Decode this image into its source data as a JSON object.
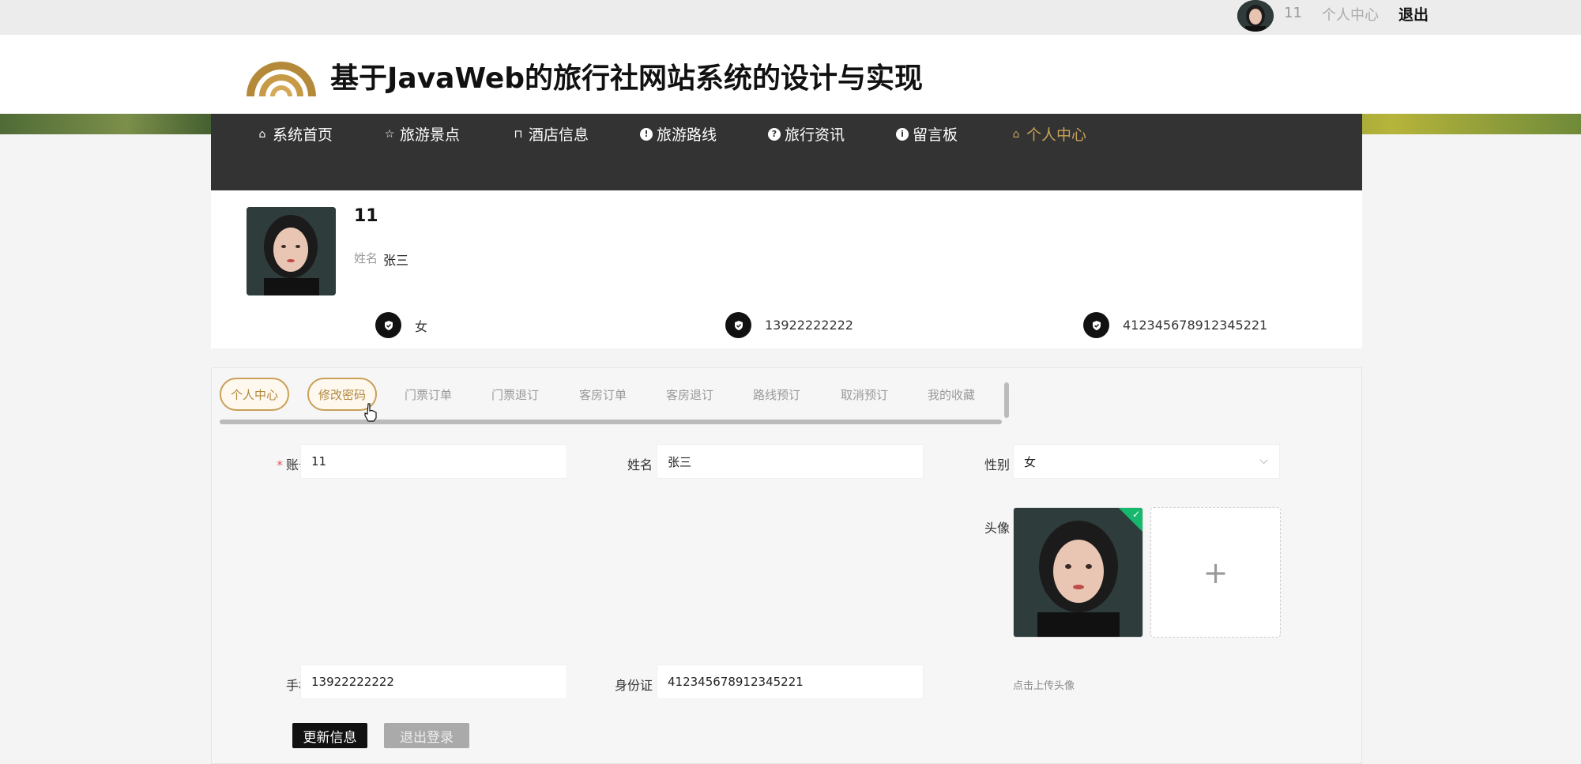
{
  "topbar": {
    "username": "11",
    "center_link": "个人中心",
    "logout": "退出"
  },
  "header": {
    "title": "基于JavaWeb的旅行社网站系统的设计与实现"
  },
  "nav": [
    {
      "label": "系统首页",
      "icon": "home-icon"
    },
    {
      "label": "旅游景点",
      "icon": "star-icon"
    },
    {
      "label": "酒店信息",
      "icon": "bag-icon"
    },
    {
      "label": "旅游路线",
      "icon": "alert-icon"
    },
    {
      "label": "旅行资讯",
      "icon": "question-icon"
    },
    {
      "label": "留言板",
      "icon": "info-icon"
    },
    {
      "label": "个人中心",
      "icon": "home-icon",
      "active": true
    }
  ],
  "profile": {
    "account": "11",
    "name_label": "姓名",
    "name": "张三",
    "gender": "女",
    "phone": "13922222222",
    "id_card": "412345678912345221"
  },
  "tabs": [
    {
      "label": "个人中心",
      "selected": true
    },
    {
      "label": "修改密码",
      "selected": true
    },
    {
      "label": "门票订单"
    },
    {
      "label": "门票退订"
    },
    {
      "label": "客房订单"
    },
    {
      "label": "客房退订"
    },
    {
      "label": "路线预订"
    },
    {
      "label": "取消预订"
    },
    {
      "label": "我的收藏"
    }
  ],
  "form": {
    "account_label": "账号",
    "account_value": "11",
    "name_label": "姓名",
    "name_value": "张三",
    "gender_label": "性别",
    "gender_value": "女",
    "avatar_label": "头像",
    "upload_tip": "点击上传头像",
    "phone_label": "手机",
    "phone_value": "13922222222",
    "id_label": "身份证",
    "id_value": "412345678912345221",
    "update_button": "更新信息",
    "logout_button": "退出登录"
  },
  "colors": {
    "accent": "#c9a15a",
    "nav_bg": "#333333",
    "success": "#15b86c"
  }
}
